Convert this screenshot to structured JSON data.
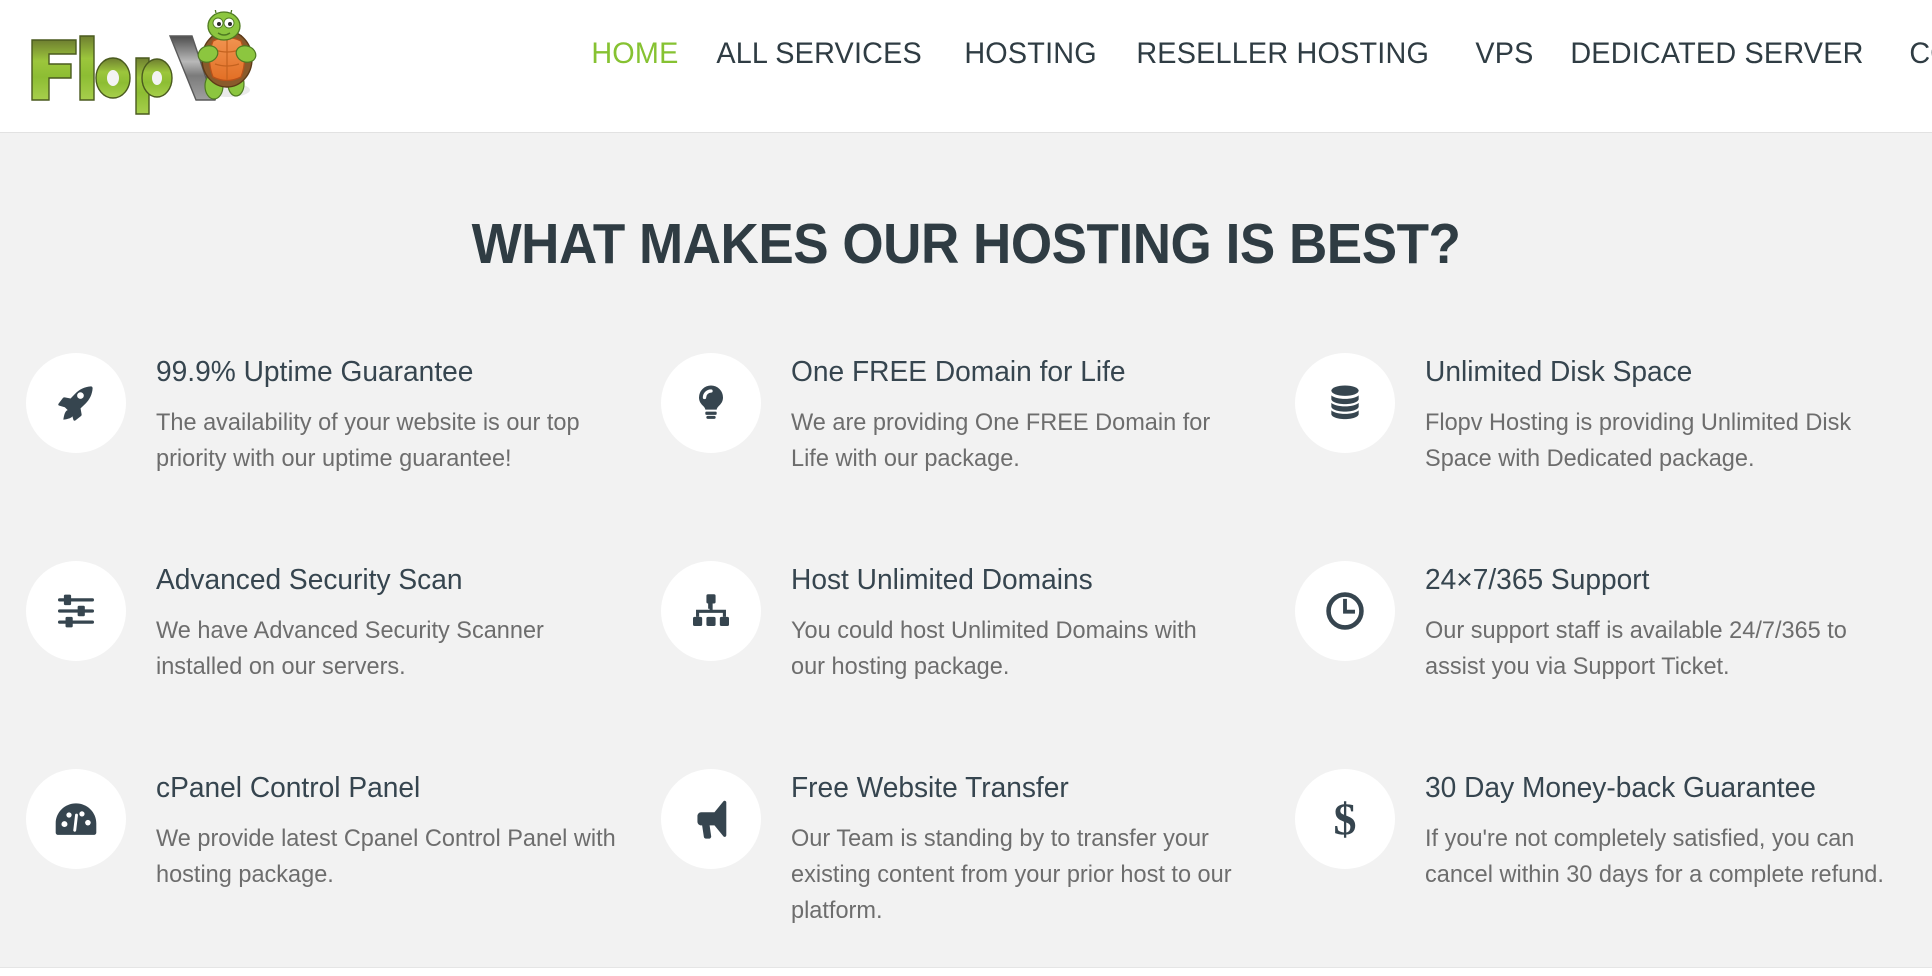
{
  "header": {
    "logo": {
      "text": "FlopV",
      "alt": "FlopV turtle logo",
      "colors": {
        "text_green": "#8cc63f",
        "text_gray": "#8d8d8d",
        "shell_orange": "#ef7f35",
        "turtle_green": "#8cc63f",
        "shell_brown": "#8a5a2b"
      }
    },
    "nav": [
      {
        "label": "HOME",
        "active": true
      },
      {
        "label": "ALL SERVICES",
        "active": false
      },
      {
        "label": "HOSTING",
        "active": false
      },
      {
        "label": "RESELLER HOSTING",
        "active": false
      },
      {
        "label": "VPS",
        "active": false
      },
      {
        "label": "DEDICATED SERVER",
        "active": false
      },
      {
        "label": "CONTACT",
        "active": false
      }
    ],
    "active_color": "#86c232",
    "inactive_color": "#2f3c43"
  },
  "main": {
    "section_title": "WHAT MAKES OUR HOSTING IS BEST?",
    "title_color": "#2f3c43",
    "background_color": "#f2f2f2",
    "features": [
      {
        "icon": "rocket-icon",
        "title": "99.9% Uptime Guarantee",
        "description": "The availability of your website is our top priority with our uptime guarantee!"
      },
      {
        "icon": "lightbulb-icon",
        "title": "One FREE Domain for Life",
        "description": "We are providing One FREE Domain for Life with our package."
      },
      {
        "icon": "database-icon",
        "title": "Unlimited Disk Space",
        "description": "Flopv Hosting is providing Unlimited Disk Space with Dedicated package."
      },
      {
        "icon": "sliders-icon",
        "title": "Advanced Security Scan",
        "description": "We have Advanced Security Scanner installed on our servers."
      },
      {
        "icon": "sitemap-icon",
        "title": "Host Unlimited Domains",
        "description": "You could host Unlimited Domains with our hosting package."
      },
      {
        "icon": "clock-icon",
        "title": "24×7/365 Support",
        "description": "Our support staff is available 24/7/365 to assist you via Support Ticket."
      },
      {
        "icon": "dashboard-icon",
        "title": "cPanel Control Panel",
        "description": "We provide latest Cpanel Control Panel with hosting package."
      },
      {
        "icon": "megaphone-icon",
        "title": "Free Website Transfer",
        "description": "Our Team is standing by to transfer your existing content from your prior host to our platform."
      },
      {
        "icon": "dollar-icon",
        "title": "30 Day Money-back Guarantee",
        "description": "If you're not completely satisfied, you can cancel within 30 days for a complete refund."
      }
    ]
  }
}
